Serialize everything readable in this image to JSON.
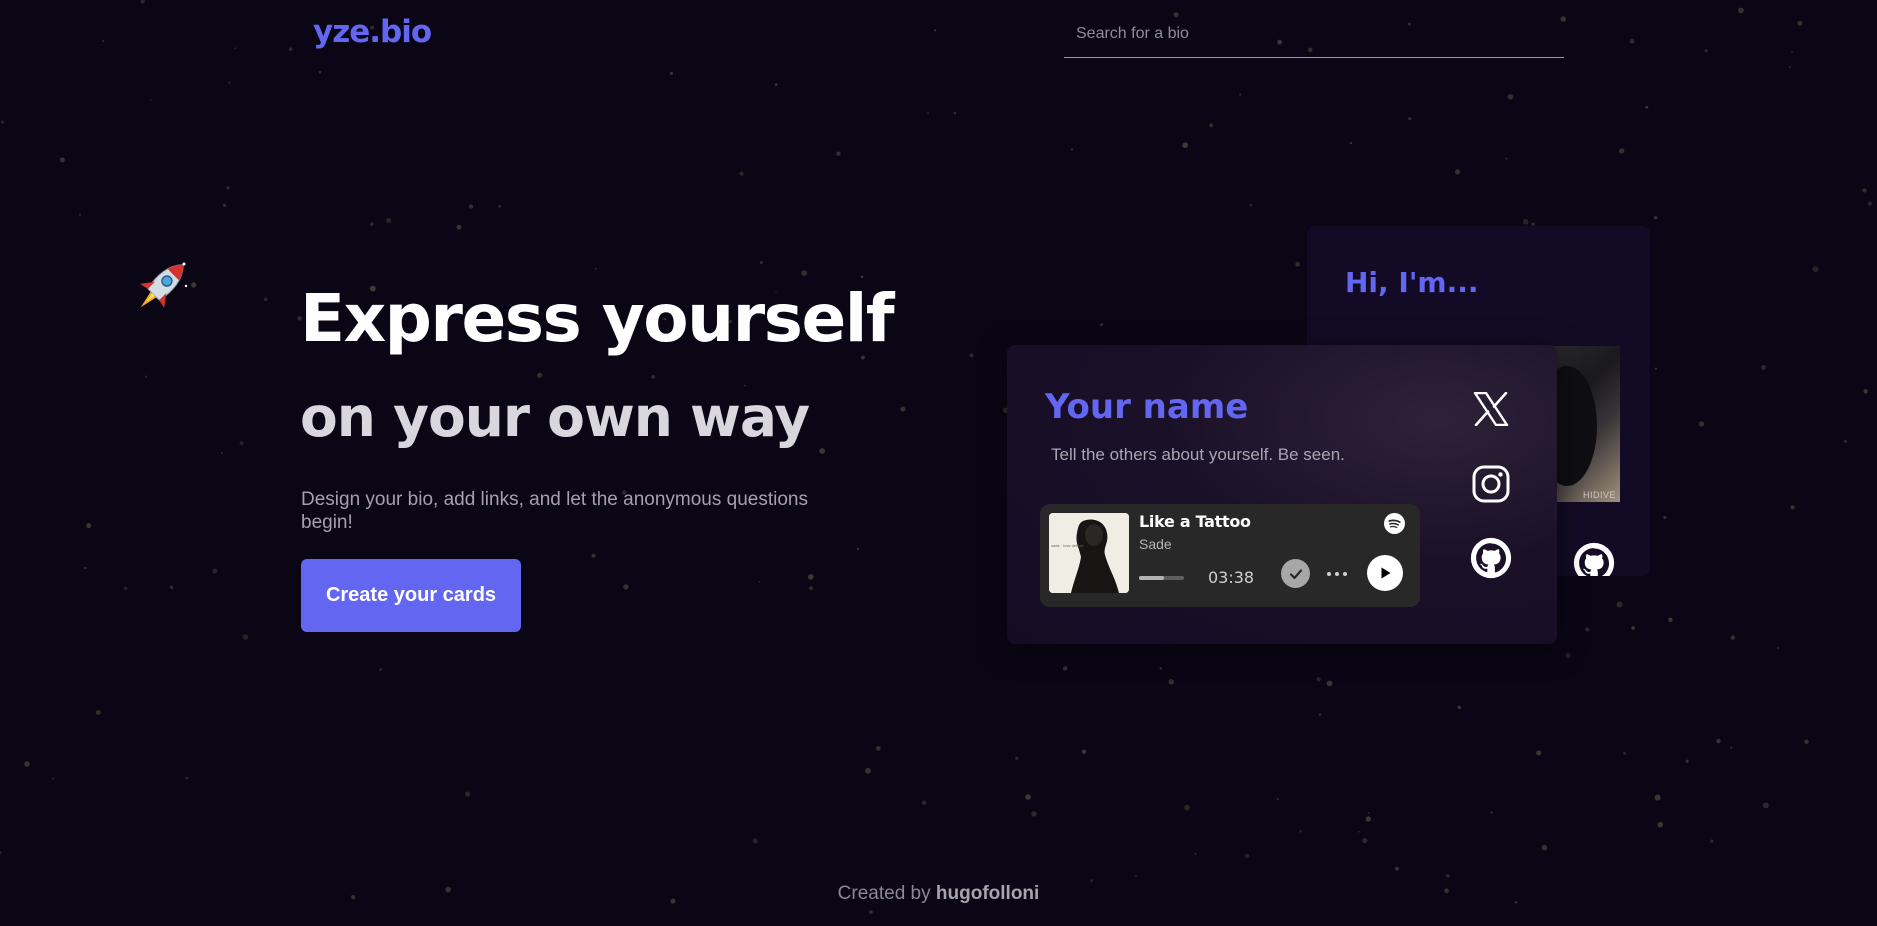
{
  "header": {
    "logo": "yze.bio",
    "search_placeholder": "Search for a bio"
  },
  "hero": {
    "title": "Express yourself",
    "subtitle": "on your own way",
    "description": "Design your bio, add links, and let the anonymous questions begin!",
    "cta_label": "Create your cards",
    "decor_icon": "rocket-icon"
  },
  "preview": {
    "back_card": {
      "title": "Hi, I'm...",
      "photo_label": "HIDIVE",
      "social_icon": "github-icon"
    },
    "front_card": {
      "name": "Your name",
      "bio": "Tell the others about yourself. Be seen.",
      "socials": [
        "x-icon",
        "instagram-icon",
        "github-icon"
      ],
      "spotify": {
        "song": "Like a Tattoo",
        "artist": "Sade",
        "duration": "03:38",
        "progress": 0.55,
        "icons": [
          "spotify-icon",
          "check-icon",
          "more-icon",
          "play-icon"
        ]
      }
    }
  },
  "footer": {
    "prefix": "Created by",
    "author": "hugofolloni"
  },
  "colors": {
    "background": "#0b0616",
    "accent": "#6366f1",
    "card": "#150b24",
    "spotify_bg": "#282828"
  }
}
